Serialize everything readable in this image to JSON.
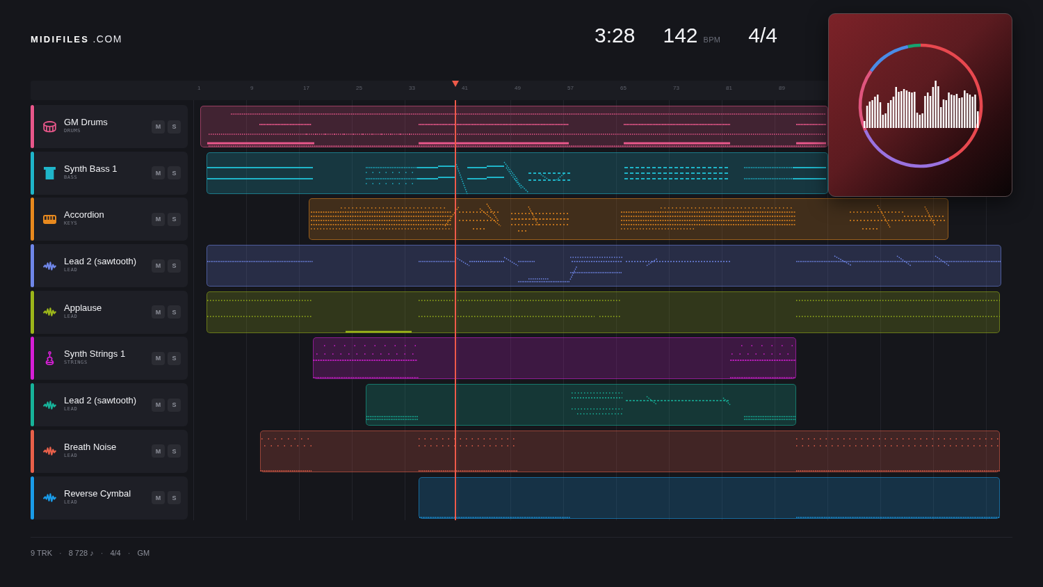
{
  "brand": {
    "logo": "**MIDIFILES** .COM"
  },
  "transport": {
    "time": "3:28",
    "tempo": "142",
    "tempo_unit": "BPM",
    "meter": "4/4"
  },
  "ruler": {
    "labels": [
      "1",
      "9",
      "17",
      "25",
      "33",
      "41",
      "49",
      "57",
      "65",
      "73",
      "81",
      "89"
    ]
  },
  "playhead": {
    "level": 0.319
  },
  "tracks": [
    {
      "name": "GM Drums",
      "category": "DRUMS",
      "kind": "drums",
      "color": "#e8578a",
      "mute": {
        "label": "M",
        "on": false
      },
      "solo": {
        "label": "S",
        "on": false
      }
    },
    {
      "name": "Synth Bass 1",
      "category": "BASS",
      "kind": "bass",
      "color": "#1fb5c9",
      "mute": {
        "label": "M",
        "on": false
      },
      "solo": {
        "label": "S",
        "on": false
      }
    },
    {
      "name": "Accordion",
      "category": "KEYS",
      "kind": "keys",
      "color": "#e8891e",
      "mute": {
        "label": "M",
        "on": false
      },
      "solo": {
        "label": "S",
        "on": false
      }
    },
    {
      "name": "Lead 2 (sawtooth)",
      "category": "LEAD",
      "kind": "lead",
      "color": "#6f86e8",
      "mute": {
        "label": "M",
        "on": false
      },
      "solo": {
        "label": "S",
        "on": false
      }
    },
    {
      "name": "Applause",
      "category": "LEAD",
      "kind": "lead",
      "color": "#9bb51a",
      "mute": {
        "label": "M",
        "on": false
      },
      "solo": {
        "label": "S",
        "on": false
      }
    },
    {
      "name": "Synth Strings 1",
      "category": "STRINGS",
      "kind": "strings",
      "color": "#d61fd6",
      "mute": {
        "label": "M",
        "on": false
      },
      "solo": {
        "label": "S",
        "on": false
      }
    },
    {
      "name": "Lead 2 (sawtooth)",
      "category": "LEAD",
      "kind": "lead",
      "color": "#17b39a",
      "mute": {
        "label": "M",
        "on": false
      },
      "solo": {
        "label": "S",
        "on": false
      }
    },
    {
      "name": "Breath Noise",
      "category": "LEAD",
      "kind": "lead",
      "color": "#e8604a",
      "mute": {
        "label": "M",
        "on": false
      },
      "solo": {
        "label": "S",
        "on": false
      }
    },
    {
      "name": "Reverse Cymbal",
      "category": "LEAD",
      "kind": "lead",
      "color": "#1a9be8",
      "mute": {
        "label": "M",
        "on": false
      },
      "solo": {
        "label": "S",
        "on": false
      }
    }
  ],
  "status_bar": {
    "items": [
      {
        "text": "9 TRK",
        "kind": "stat"
      },
      {
        "text": "·",
        "kind": "separator"
      },
      {
        "text": "8 728 ♪",
        "kind": "stat"
      },
      {
        "text": "·",
        "kind": "separator"
      },
      {
        "text": "4/4",
        "kind": "stat"
      },
      {
        "text": "·",
        "kind": "separator"
      },
      {
        "text": "GM",
        "kind": "stat"
      }
    ]
  }
}
